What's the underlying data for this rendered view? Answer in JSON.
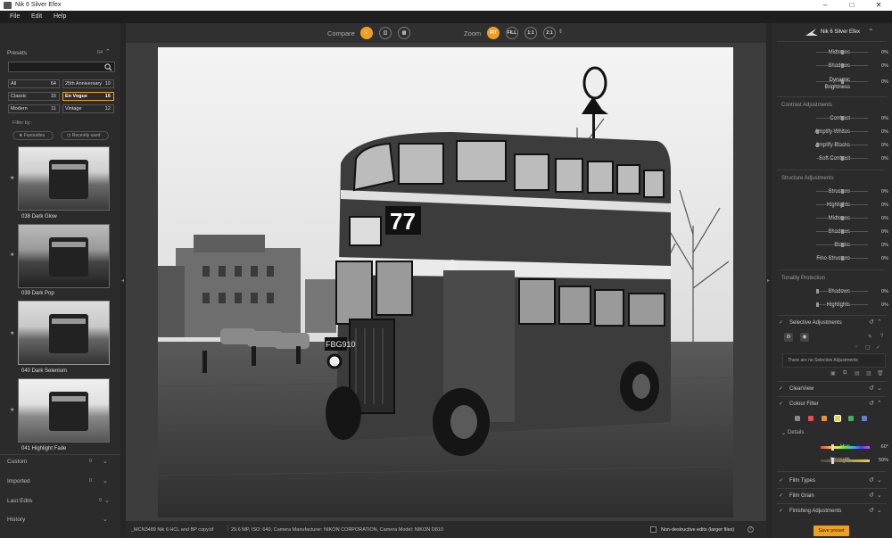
{
  "window": {
    "title": "Nik 6 Silver Efex",
    "minimize": "–",
    "maximize": "□",
    "close": "✕"
  },
  "menu": {
    "file": "File",
    "edit": "Edit",
    "help": "Help"
  },
  "presets": {
    "title": "Presets",
    "count": "64",
    "search_placeholder": "",
    "categories": [
      {
        "label": "All",
        "count": "64"
      },
      {
        "label": "25th Anniversary",
        "count": "10"
      },
      {
        "label": "Classic",
        "count": "15"
      },
      {
        "label": "En Vogue",
        "count": "16"
      },
      {
        "label": "Modern",
        "count": "11"
      },
      {
        "label": "Vintage",
        "count": "12"
      }
    ],
    "filter_by": "Filter by:",
    "favourites": "Favourites",
    "recently_used": "Recently used",
    "items": [
      {
        "label": "038 Dark Glow"
      },
      {
        "label": "039 Dark Pop"
      },
      {
        "label": "040 Dark Selenium"
      },
      {
        "label": "041 Highlight Fade"
      }
    ],
    "custom": {
      "label": "Custom",
      "count": "0"
    },
    "imported": {
      "label": "Imported",
      "count": "0"
    },
    "last_edits": {
      "label": "Last Edits",
      "count": "0"
    },
    "history": {
      "label": "History"
    }
  },
  "toolbar": {
    "compare": "Compare",
    "zoom": "Zoom",
    "fit": "FIT",
    "fill": "FILL",
    "z11": "1:1",
    "z21": "2:1"
  },
  "photo": {
    "route": "77",
    "plate": "FBG910"
  },
  "status": {
    "filename": "_MCN3489 Nik 6 HCL and BP copy.tif",
    "info": "29.6 MP, ISO: 640, Camera Manufacturer: NIKON CORPORATION, Camera Model: NIKON D810",
    "nondestructive": "Non-destructive edits (larger files)"
  },
  "right": {
    "title": "Nik 6 Silver Efex",
    "top": [
      {
        "label": "Midtones",
        "value": "0%"
      },
      {
        "label": "Shadows",
        "value": "0%"
      },
      {
        "label": "Dynamic Brightness",
        "value": "0%"
      }
    ],
    "contrast_title": "Contrast Adjustments",
    "contrast": [
      {
        "label": "Contrast",
        "value": "0%"
      },
      {
        "label": "Amplify Whites",
        "value": "0%"
      },
      {
        "label": "Amplify Blacks",
        "value": "0%"
      },
      {
        "label": "Soft Contrast",
        "value": "0%"
      }
    ],
    "structure_title": "Structure Adjustments",
    "structure": [
      {
        "label": "Structure",
        "value": "0%"
      },
      {
        "label": "Highlights",
        "value": "0%"
      },
      {
        "label": "Midtones",
        "value": "0%"
      },
      {
        "label": "Shadows",
        "value": "0%"
      },
      {
        "label": "Blacks",
        "value": "0%"
      },
      {
        "label": "Fine Structure",
        "value": "0%"
      }
    ],
    "tonality_title": "Tonality Protection",
    "tonality": [
      {
        "label": "Shadows",
        "value": "0%"
      },
      {
        "label": "Highlights",
        "value": "0%"
      }
    ],
    "selective": "Selective Adjustments",
    "no_selective": "There are no Selective Adjustments",
    "clearview": "ClearView",
    "colour_filter": "Colour Filter",
    "swatches": [
      "#888888",
      "#e05050",
      "#e89040",
      "#e8d050",
      "#40b060",
      "#6080d0"
    ],
    "details": "Details",
    "hue": {
      "label": "Hue",
      "value": "60°"
    },
    "strength": {
      "label": "Strength",
      "value": "50%"
    },
    "film_types": "Film Types",
    "film_grain": "Film Grain",
    "finishing": "Finishing Adjustments",
    "save_preset": "Save preset"
  }
}
